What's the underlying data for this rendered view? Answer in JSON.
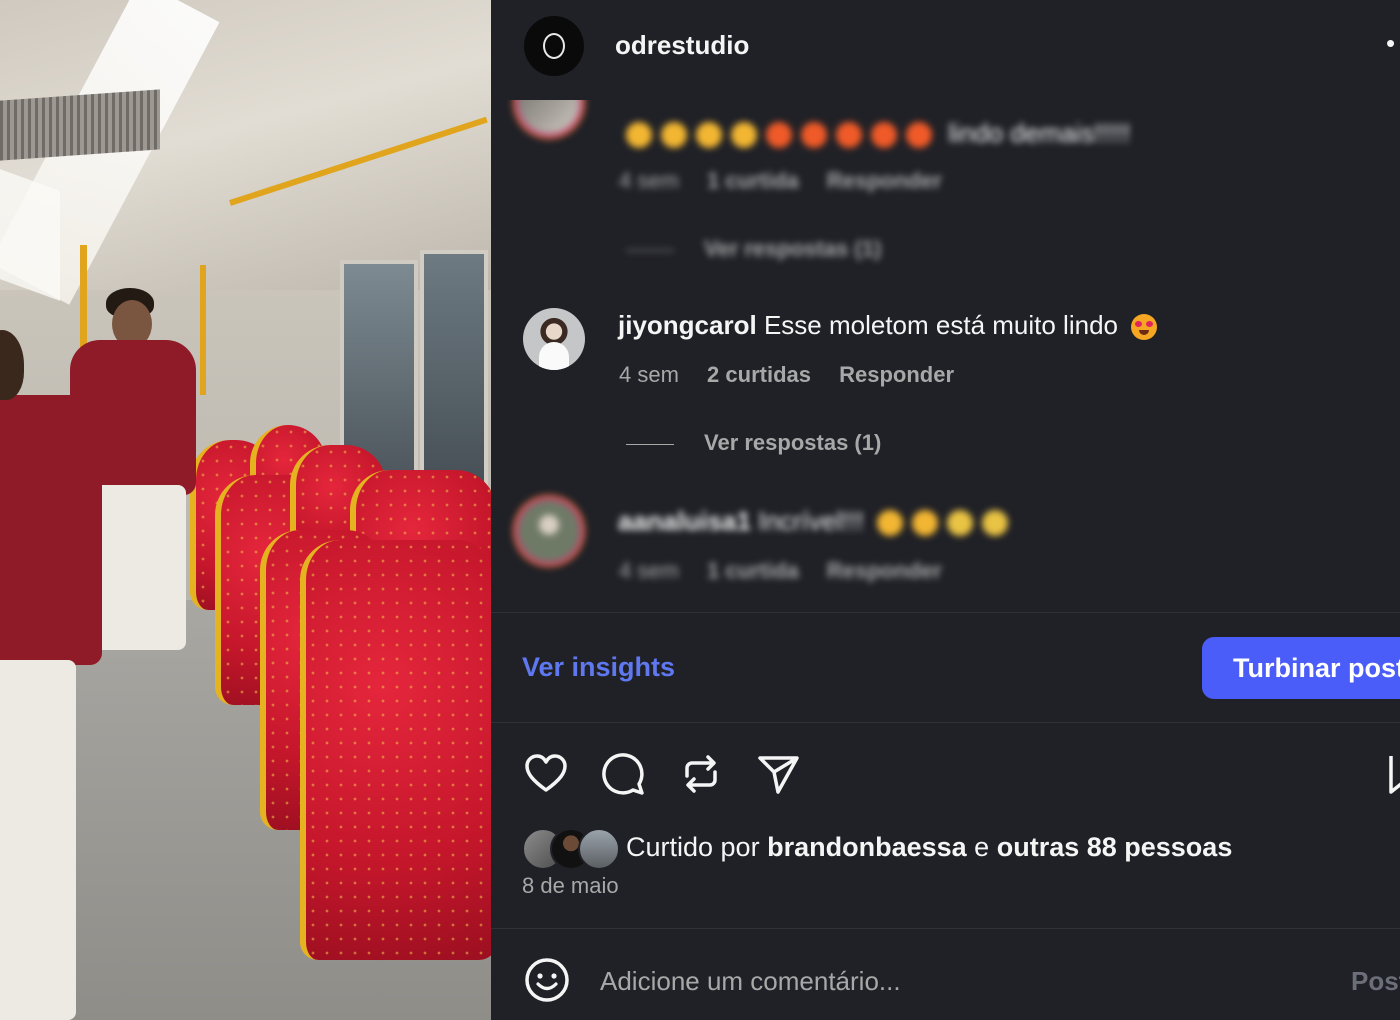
{
  "header": {
    "username": "odrestudio",
    "more_icon": "more-icon"
  },
  "comments": [
    {
      "username": "",
      "text": "lindo demais!!!!!",
      "time": "4 sem",
      "likes": "1 curtida",
      "reply": "Responder",
      "view_replies": "Ver respostas (1)",
      "blurred": true
    },
    {
      "username": "jiyongcarol",
      "text": "Esse moletom está muito lindo",
      "emoji": "heart-eyes-emoji",
      "time": "4 sem",
      "likes": "2 curtidas",
      "reply": "Responder",
      "view_replies": "Ver respostas (1)",
      "blurred": false
    },
    {
      "username": "aanaluisa1",
      "text": "Incrível!!!",
      "time": "4 sem",
      "likes": "1 curtida",
      "reply": "Responder",
      "blurred": true
    }
  ],
  "insights": {
    "label": "Ver insights"
  },
  "boost": {
    "label": "Turbinar post"
  },
  "likes": {
    "prefix": "Curtido por",
    "user": "brandonbaessa",
    "conjunction": "e",
    "others": "outras 88 pessoas"
  },
  "date": "8 de maio",
  "comment_input": {
    "placeholder": "Adicione um comentário...",
    "post_label": "Post"
  },
  "colors": {
    "background": "#202127",
    "accent": "#4a5df9",
    "link": "#5f78f0",
    "muted": "#a8a8a8"
  }
}
